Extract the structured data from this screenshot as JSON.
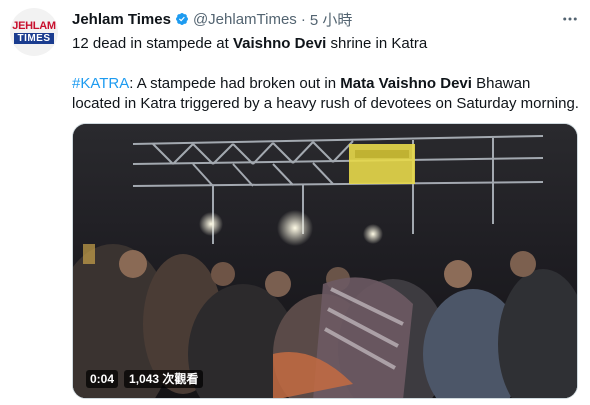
{
  "tweet": {
    "author_name": "Jehlam Times",
    "handle": "@JehlamTimes",
    "separator": "·",
    "timestamp": "5 小時",
    "avatar": {
      "logo_top": "JEHLAM",
      "logo_bottom": "TIMES"
    },
    "verified_icon": "verified-badge-icon",
    "more_icon": "more-options-icon",
    "text": {
      "line1": {
        "before": "12 dead in stampede at ",
        "bold": "Vaishno Devi",
        "after": " shrine in Katra"
      },
      "line2": {
        "hashtag": "#KATRA",
        "before": ": A stampede had broken out in ",
        "bold": "Mata Vaishno Devi",
        "after": " Bhawan"
      },
      "line3": "located in Katra triggered by a heavy rush of devotees on Saturday morning."
    },
    "video": {
      "duration": "0:04",
      "views": "1,043 次觀看"
    }
  },
  "colors": {
    "text": "#0f1419",
    "secondary": "#536471",
    "accent": "#1d9bf0",
    "border": "#cfd9de"
  }
}
